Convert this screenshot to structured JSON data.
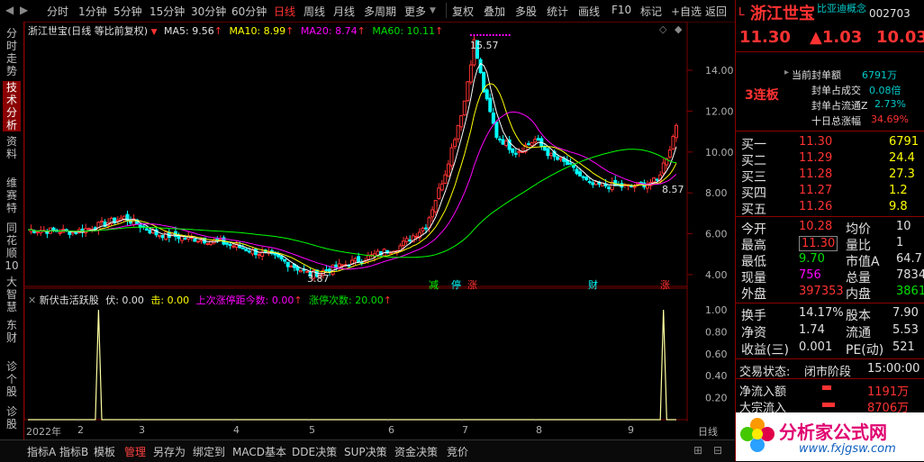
{
  "topbar": {
    "items": [
      "分时",
      "1分钟",
      "5分钟",
      "15分钟",
      "30分钟",
      "60分钟",
      "日线",
      "周线",
      "月线",
      "多周期",
      "更多"
    ],
    "tools": [
      "复权",
      "叠加",
      "多股",
      "统计",
      "画线",
      "F10",
      "标记",
      "+自选",
      "返回"
    ]
  },
  "left_tabs": [
    "分时走势",
    "技术分析",
    "资料",
    "维赛特",
    "同花顺10",
    "大智慧",
    "东财",
    "诊个股",
    "诊股"
  ],
  "main_chart": {
    "title": "浙江世宝(日线 等比前复权)",
    "ma5": "MA5: 9.56",
    "ma10": "MA10: 8.99",
    "ma20": "MA20: 8.74",
    "ma60": "MA60: 10.11",
    "high_label": "15.57",
    "low_label": "3.87",
    "last_label": "8.57",
    "yticks": [
      "14.00",
      "12.00",
      "10.00",
      "8.00",
      "6.00",
      "4.00"
    ],
    "markers": [
      "减",
      "停",
      "涨",
      "财",
      "涨"
    ],
    "colors": {
      "ma5": "#ffffff",
      "ma10": "#ffff00",
      "ma20": "#ff00ff",
      "ma60": "#00ff00",
      "up": "#ff3232",
      "down": "#00ffff"
    }
  },
  "indicator": {
    "name": "新伏击活跃股",
    "fu": "伏: 0.00",
    "ji": "击: 0.00",
    "last_limit": "上次涨停距今数: 0.00",
    "limit_count": "涨停次数: 20.00",
    "yticks": [
      "1.00",
      "0.80",
      "0.60",
      "0.40",
      "0.20"
    ],
    "xlabels": [
      "2022年",
      "2",
      "3",
      "4",
      "5",
      "6",
      "7",
      "8",
      "9"
    ],
    "period": "日线"
  },
  "bottombar": {
    "items": [
      "指标A",
      "指标B",
      "模板",
      "管理",
      "另存为",
      "绑定到",
      "MACD基本",
      "DDE决策",
      "SUP决策",
      "资金决策",
      "竞价"
    ]
  },
  "quote": {
    "name": "浙江世宝",
    "concept": "比亚迪概念",
    "code": "002703",
    "price": "11.30",
    "change": "▲1.03",
    "pct": "10.03",
    "seal_amount_label": "当前封单额",
    "seal_amount": "6791万",
    "seal_vol_label": "封单占成交",
    "seal_vol": "0.08倍",
    "seal_float_label": "封单占流通Z",
    "seal_float": "2.73%",
    "ten_day_label": "十日总涨幅",
    "ten_day": "34.69%",
    "streak": "3连板",
    "bids": [
      {
        "label": "买一",
        "price": "11.30",
        "vol": "6791"
      },
      {
        "label": "买二",
        "price": "11.29",
        "vol": "24.4"
      },
      {
        "label": "买三",
        "price": "11.28",
        "vol": "27.3"
      },
      {
        "label": "买四",
        "price": "11.27",
        "vol": "1.2"
      },
      {
        "label": "买五",
        "price": "11.26",
        "vol": "9.8"
      }
    ],
    "stats": [
      {
        "l1": "今开",
        "v1": "10.28",
        "l2": "均价",
        "v2": "10"
      },
      {
        "l1": "最高",
        "v1": "11.30",
        "l2": "量比",
        "v2": "1"
      },
      {
        "l1": "最低",
        "v1": "9.70",
        "l2": "市值A",
        "v2": "64.7"
      },
      {
        "l1": "现量",
        "v1": "756",
        "l2": "总量",
        "v2": "7834"
      },
      {
        "l1": "外盘",
        "v1": "397353",
        "l2": "内盘",
        "v2": "3861"
      }
    ],
    "stats2": [
      {
        "l1": "换手",
        "v1": "14.17%",
        "l2": "股本",
        "v2": "7.90"
      },
      {
        "l1": "净资",
        "v1": "1.74",
        "l2": "流通",
        "v2": "5.53"
      },
      {
        "l1": "收益(三)",
        "v1": "0.001",
        "l2": "PE(动)",
        "v2": "521"
      }
    ],
    "trade_status_label": "交易状态:",
    "trade_status": "闭市阶段",
    "trade_time": "15:00:00",
    "net_inflow_label": "净流入额",
    "net_inflow": "1191万",
    "big_inflow_label": "大宗流入",
    "big_inflow": "8706万"
  },
  "watermark": {
    "text": "分析家公式网",
    "url": "www.fxjgsw.com"
  }
}
